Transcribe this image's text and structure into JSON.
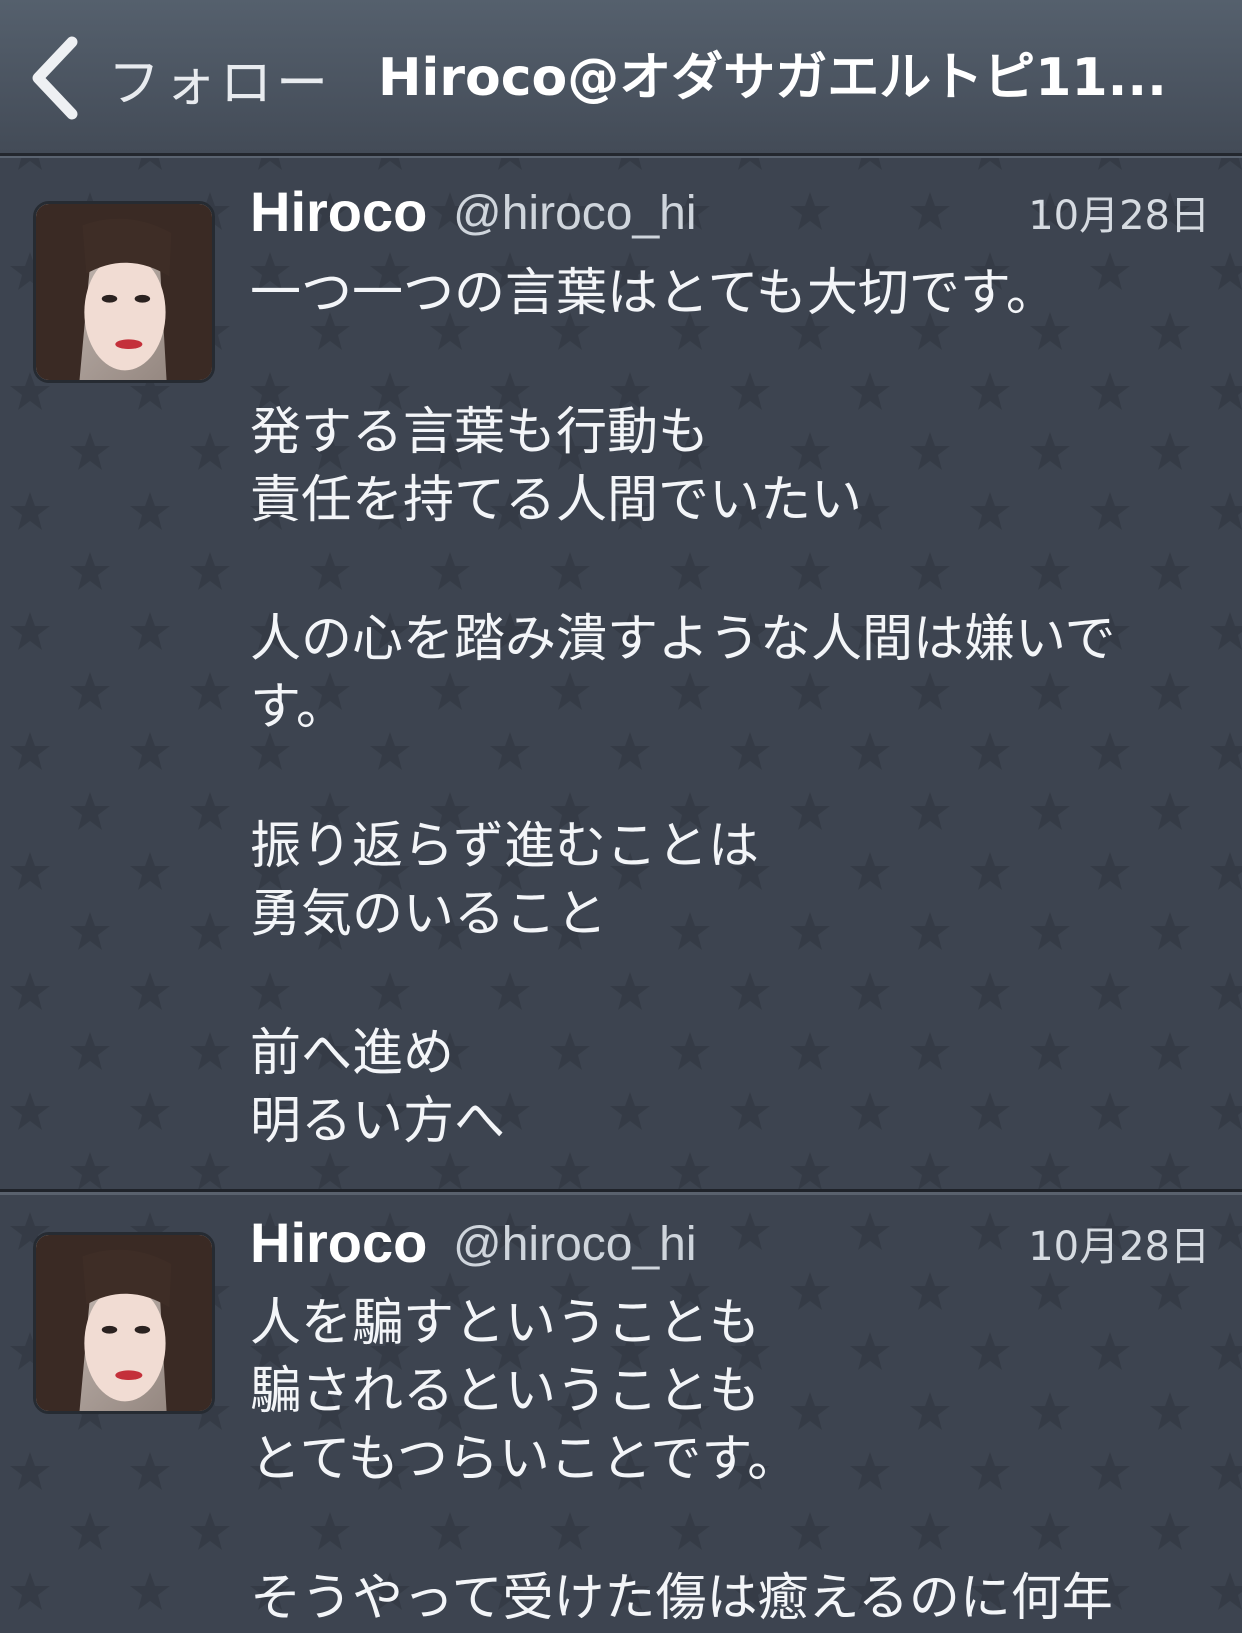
{
  "nav": {
    "back_label": "フォロー",
    "title": "Hiroco@オダサガエルトピ11..."
  },
  "tweets": [
    {
      "name": "Hiroco",
      "handle": "@hiroco_hi",
      "date": "10月28日",
      "lines": [
        "一つ一つの言葉はとても大切です。",
        "",
        "発する言葉も行動も",
        "責任を持てる人間でいたい",
        "",
        "人の心を踏み潰すような人間は嫌いで",
        "す。",
        "",
        "振り返らず進むことは",
        "勇気のいること",
        "",
        "前へ進め",
        "明るい方へ"
      ]
    },
    {
      "name": "Hiroco",
      "handle": "@hiroco_hi",
      "date": "10月28日",
      "lines": [
        "人を騙すということも",
        "騙されるということも",
        "とてもつらいことです。",
        "",
        "そうやって受けた傷は癒えるのに何年"
      ]
    }
  ],
  "icons": {
    "back": "chevron-left-icon",
    "avatar": "avatar"
  },
  "colors": {
    "background": "#3d4450",
    "navbar": "#4c5561",
    "text": "#f3f5f8"
  }
}
